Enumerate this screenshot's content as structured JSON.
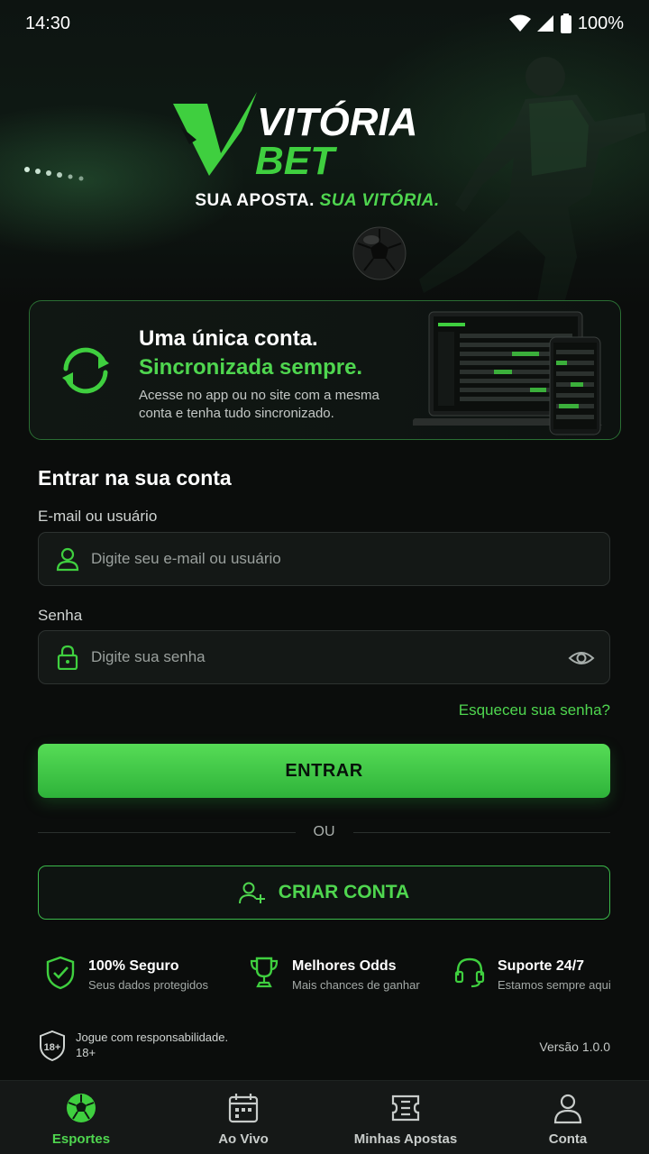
{
  "status_bar": {
    "time": "14:30",
    "battery": "100%",
    "icons": [
      "wifi-icon",
      "signal-icon",
      "battery-icon"
    ]
  },
  "brand": {
    "name_top": "VITÓRIA",
    "name_bottom": "BET",
    "tagline_white": "SUA APOSTA.",
    "tagline_green": "SUA VITÓRIA."
  },
  "sync_card": {
    "title": "Uma única conta.",
    "subtitle": "Sincronizada sempre.",
    "description": "Acesse no app ou no site com a mesma conta e tenha tudo sincronizado."
  },
  "login": {
    "section_title": "Entrar na sua conta",
    "email_label": "E-mail ou usuário",
    "email_placeholder": "Digite seu e-mail ou usuário",
    "password_label": "Senha",
    "password_placeholder": "Digite sua senha",
    "forgot_link": "Esqueceu sua senha?",
    "submit_label": "ENTRAR",
    "divider_text": "OU",
    "create_label": "CRIAR CONTA"
  },
  "features": [
    {
      "title": "100% Seguro",
      "subtitle": "Seus dados protegidos",
      "icon": "shield-check-icon"
    },
    {
      "title": "Melhores Odds",
      "subtitle": "Mais chances de ganhar",
      "icon": "trophy-icon"
    },
    {
      "title": "Suporte 24/7",
      "subtitle": "Estamos sempre aqui",
      "icon": "headset-icon"
    }
  ],
  "footer": {
    "responsibility_line1": "Jogue com responsabilidade.",
    "responsibility_line2": "18+",
    "age_badge": "18+",
    "version": "Versão 1.0.0"
  },
  "nav": [
    {
      "label": "Esportes",
      "icon": "soccer-ball-icon",
      "active": true
    },
    {
      "label": "Ao Vivo",
      "icon": "calendar-live-icon",
      "active": false
    },
    {
      "label": "Minhas Apostas",
      "icon": "ticket-icon",
      "active": false
    },
    {
      "label": "Conta",
      "icon": "user-icon",
      "active": false
    }
  ],
  "colors": {
    "accent": "#4fd64f",
    "background": "#0b0d0c",
    "card_border": "#2a6e33"
  }
}
